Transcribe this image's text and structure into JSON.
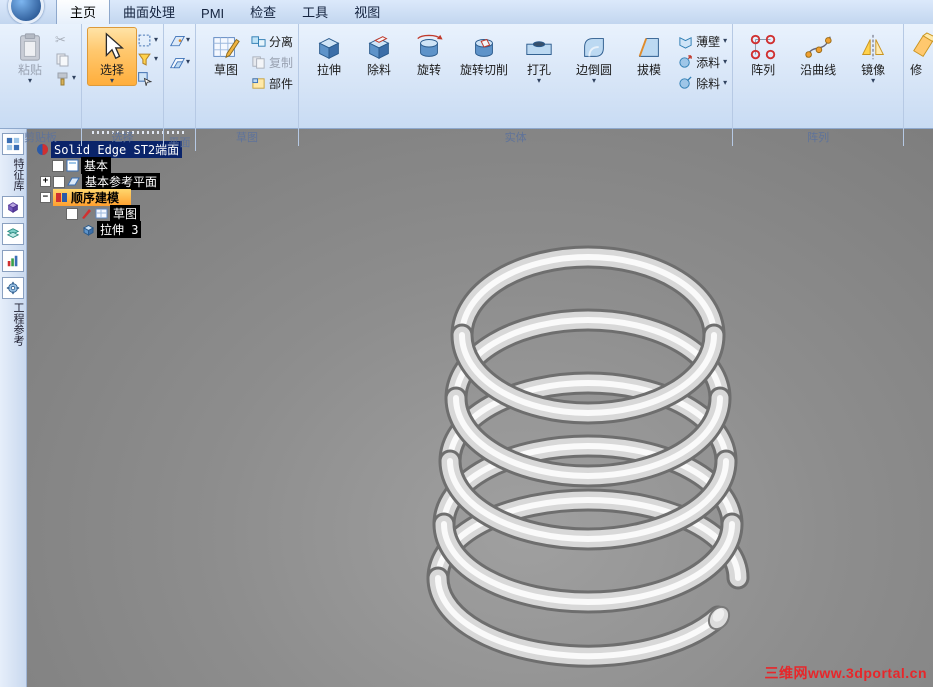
{
  "tabs": [
    {
      "label": "主页"
    },
    {
      "label": "曲面处理"
    },
    {
      "label": "PMI"
    },
    {
      "label": "检查"
    },
    {
      "label": "工具"
    },
    {
      "label": "视图"
    }
  ],
  "ribbon": {
    "clipboard": {
      "group": "剪贴板",
      "paste": "粘贴"
    },
    "select": {
      "group": "选择",
      "main": "选择"
    },
    "plane": {
      "group": "平面"
    },
    "sketch": {
      "group": "草图",
      "main": "草图",
      "detach": "分离",
      "copy": "复制",
      "part": "部件"
    },
    "solids": {
      "group": "实体",
      "extrude": "拉伸",
      "cut": "除料",
      "revolve": "旋转",
      "revolved_cut": "旋转切削",
      "hole": "打孔",
      "round": "边倒圆",
      "draft": "拔模",
      "thin_wall": "薄壁",
      "add_material": "添料",
      "remove_material": "除料"
    },
    "pattern": {
      "group": "阵列",
      "pattern": "阵列",
      "along_curve": "沿曲线",
      "mirror": "镜像"
    },
    "overflow": {
      "label": "修"
    }
  },
  "edgebar": {
    "top_label": "特征库",
    "bottom_label": "工程参考"
  },
  "pathfinder": {
    "title": "Solid Edge ST2端面",
    "base": "基本",
    "ref_planes": "基本参考平面",
    "ordered": "顺序建模",
    "sketch": "草图",
    "extrude3": "拉伸 3"
  },
  "viewport": {
    "watermark": "三维网www.3dportal.cn"
  },
  "colors": {
    "accent_orange": "#ffae3c",
    "selection_blue": "#0a246a",
    "watermark_red": "#e8262a"
  }
}
